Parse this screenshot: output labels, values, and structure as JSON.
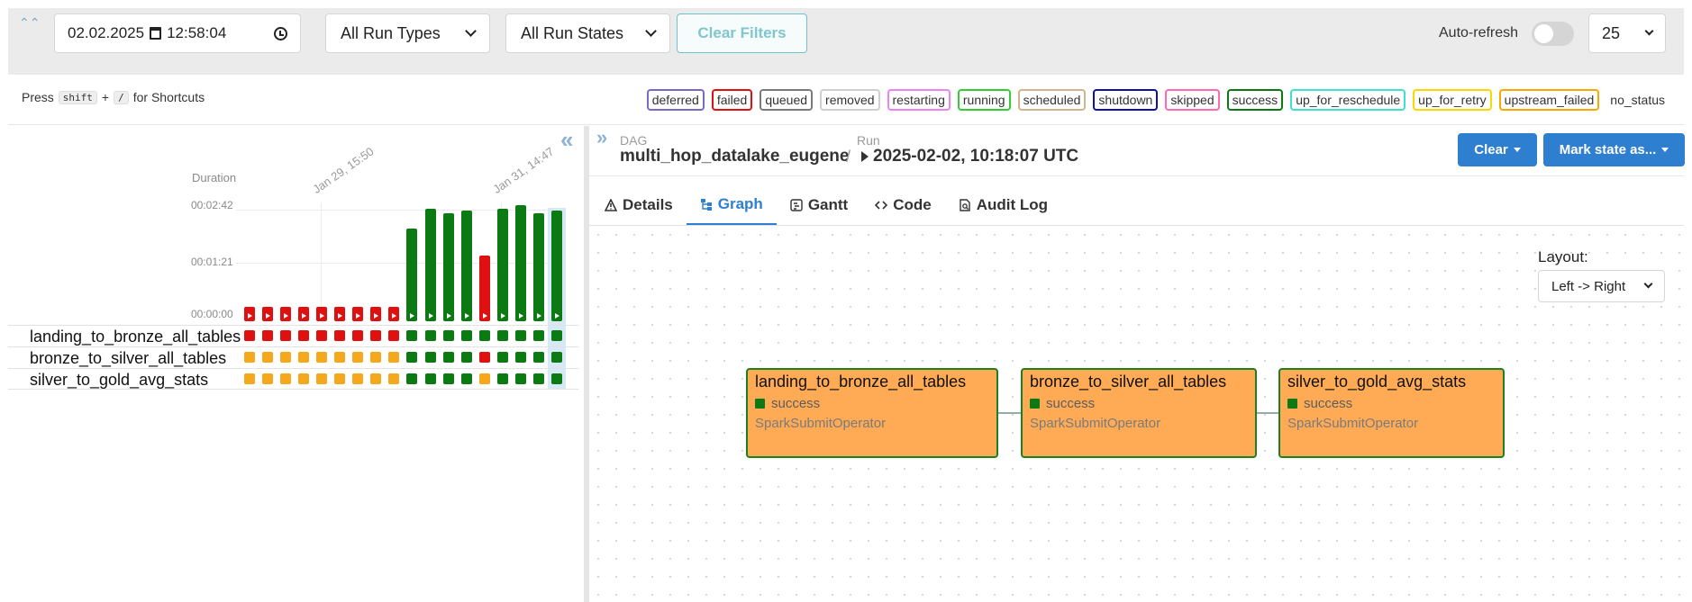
{
  "filters": {
    "date": "02.02.2025",
    "time": "12:58:04",
    "run_type": "All Run Types",
    "run_state": "All Run States",
    "clear_label": "Clear Filters",
    "autorefresh_label": "Auto-refresh",
    "autorefresh_on": false,
    "page_size": "25"
  },
  "shortcuts": {
    "press": "Press",
    "key1": "shift",
    "plus": "+",
    "key2": "/",
    "suffix": "for Shortcuts"
  },
  "legend": [
    {
      "label": "deferred",
      "color": "#7b68c8"
    },
    {
      "label": "failed",
      "color": "#e01010"
    },
    {
      "label": "queued",
      "color": "#7a7a7a"
    },
    {
      "label": "removed",
      "color": "#cfcfcf"
    },
    {
      "label": "restarting",
      "color": "#ee82ee"
    },
    {
      "label": "running",
      "color": "#32cd32"
    },
    {
      "label": "scheduled",
      "color": "#d2b48c"
    },
    {
      "label": "shutdown",
      "color": "#1010a8"
    },
    {
      "label": "skipped",
      "color": "#ff69b4"
    },
    {
      "label": "success",
      "color": "#0c7a12"
    },
    {
      "label": "up_for_reschedule",
      "color": "#40e0d0"
    },
    {
      "label": "up_for_retry",
      "color": "#ffd700"
    },
    {
      "label": "upstream_failed",
      "color": "#ffa500"
    },
    {
      "label": "no_status",
      "color": null
    }
  ],
  "grid": {
    "duration_label": "Duration",
    "y_ticks": [
      "00:02:42",
      "00:01:21",
      "00:00:00"
    ],
    "date_ticks": [
      "Jan 29, 15:50",
      "Jan 31, 14:47"
    ],
    "runs": [
      {
        "state": "failed",
        "duration_s": 0
      },
      {
        "state": "failed",
        "duration_s": 0
      },
      {
        "state": "failed",
        "duration_s": 0
      },
      {
        "state": "failed",
        "duration_s": 0
      },
      {
        "state": "failed",
        "duration_s": 0
      },
      {
        "state": "failed",
        "duration_s": 0
      },
      {
        "state": "failed",
        "duration_s": 0
      },
      {
        "state": "failed",
        "duration_s": 0
      },
      {
        "state": "failed",
        "duration_s": 0
      },
      {
        "state": "success",
        "duration_s": 135
      },
      {
        "state": "success",
        "duration_s": 163
      },
      {
        "state": "success",
        "duration_s": 157
      },
      {
        "state": "success",
        "duration_s": 161
      },
      {
        "state": "failed",
        "duration_s": 96
      },
      {
        "state": "success",
        "duration_s": 163
      },
      {
        "state": "success",
        "duration_s": 168
      },
      {
        "state": "success",
        "duration_s": 157
      },
      {
        "state": "success",
        "duration_s": 161
      }
    ],
    "tasks": [
      {
        "name": "landing_to_bronze_all_tables",
        "states": [
          "failed",
          "failed",
          "failed",
          "failed",
          "failed",
          "failed",
          "failed",
          "failed",
          "failed",
          "success",
          "success",
          "success",
          "success",
          "success",
          "success",
          "success",
          "success",
          "success"
        ]
      },
      {
        "name": "bronze_to_silver_all_tables",
        "states": [
          "upstream_failed",
          "upstream_failed",
          "upstream_failed",
          "upstream_failed",
          "upstream_failed",
          "upstream_failed",
          "upstream_failed",
          "upstream_failed",
          "upstream_failed",
          "success",
          "success",
          "success",
          "success",
          "failed",
          "success",
          "success",
          "success",
          "success"
        ]
      },
      {
        "name": "silver_to_gold_avg_stats",
        "states": [
          "upstream_failed",
          "upstream_failed",
          "upstream_failed",
          "upstream_failed",
          "upstream_failed",
          "upstream_failed",
          "upstream_failed",
          "upstream_failed",
          "upstream_failed",
          "success",
          "success",
          "success",
          "success",
          "upstream_failed",
          "success",
          "success",
          "success",
          "success"
        ]
      }
    ]
  },
  "header": {
    "dag_label": "DAG",
    "dag_id": "multi_hop_datalake_eugene",
    "sep": "/",
    "run_label": "Run",
    "run_id": "2025-02-02, 10:18:07 UTC",
    "clear_button": "Clear",
    "mark_button": "Mark state as..."
  },
  "tabs": [
    {
      "label": "Details",
      "icon": "alert-triangle-icon",
      "active": false
    },
    {
      "label": "Graph",
      "icon": "graph-icon",
      "active": true
    },
    {
      "label": "Gantt",
      "icon": "gantt-icon",
      "active": false
    },
    {
      "label": "Code",
      "icon": "code-icon",
      "active": false
    },
    {
      "label": "Audit Log",
      "icon": "audit-log-icon",
      "active": false
    }
  ],
  "graph": {
    "layout_label": "Layout:",
    "layout_value": "Left -> Right",
    "nodes": [
      {
        "name": "landing_to_bronze_all_tables",
        "status": "success",
        "operator": "SparkSubmitOperator"
      },
      {
        "name": "bronze_to_silver_all_tables",
        "status": "success",
        "operator": "SparkSubmitOperator"
      },
      {
        "name": "silver_to_gold_avg_stats",
        "status": "success",
        "operator": "SparkSubmitOperator"
      }
    ]
  },
  "colors": {
    "accent": "#2f7fd0",
    "success": "#0c7a12",
    "failed": "#e01010",
    "upstream_failed": "#f5a81c",
    "node_fill": "#ffab56"
  }
}
